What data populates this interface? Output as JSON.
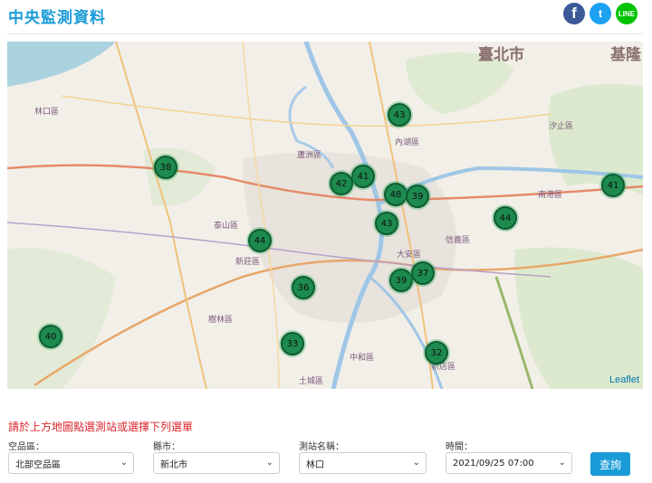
{
  "page": {
    "title": "中央監測資料"
  },
  "social": {
    "facebook_glyph": "f",
    "twitter_glyph": "t",
    "line_glyph": "LINE"
  },
  "map": {
    "attribution": "Leaflet",
    "city_labels": [
      "臺北市",
      "基隆"
    ],
    "district_labels": [
      "林口區",
      "泰山區",
      "新莊區",
      "樹林區",
      "中和區",
      "內湖區",
      "南港區",
      "汐止區",
      "蘆洲區",
      "土城區",
      "信義區",
      "大安區",
      "新店區"
    ],
    "clusters": [
      "43",
      "38",
      "41",
      "42",
      "48",
      "39",
      "43",
      "44",
      "44",
      "41",
      "36",
      "39",
      "37",
      "40",
      "33",
      "32"
    ]
  },
  "form": {
    "instruction": "請於上方地圖點選測站或選擇下列選單",
    "area": {
      "label": "空品區：",
      "value": "北部空品區"
    },
    "county": {
      "label": "縣市：",
      "value": "新北市"
    },
    "station": {
      "label": "測站名稱：",
      "value": "林口"
    },
    "time": {
      "label": "時間：",
      "value": "2021/09/25 07:00"
    },
    "query_label": "查詢"
  }
}
